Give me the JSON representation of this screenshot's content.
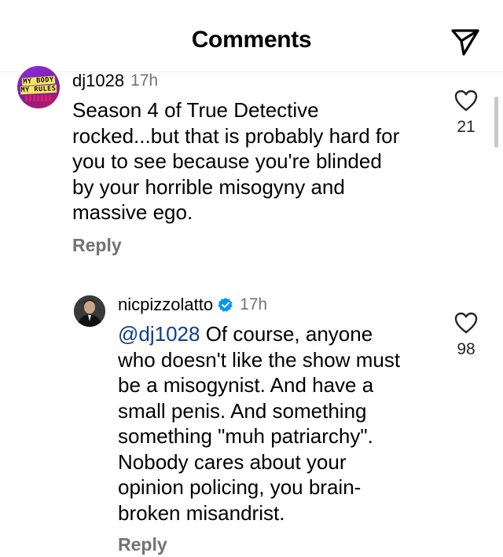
{
  "header": {
    "title": "Comments",
    "share_icon": "paper-plane-icon"
  },
  "comments": [
    {
      "avatar_text_line1": "MY BODY",
      "avatar_text_line2": "MY RULES",
      "username": "dj1028",
      "time": "17h",
      "text_lines": [
        "Season 4 of True Detective",
        "rocked...but that is probably hard for",
        "you to see because you're blinded",
        "by your horrible misogyny and",
        "massive ego."
      ],
      "reply_label": "Reply",
      "like_count": "21"
    },
    {
      "username": "nicpizzolatto",
      "verified": true,
      "time": "17h",
      "mention": "@dj1028",
      "text_first_line_rest": " Of course, anyone",
      "text_lines": [
        "who doesn't like the show must",
        "be a misogynist. And have a",
        "small penis. And something",
        "something \"muh patriarchy\".",
        "Nobody cares about your",
        "opinion policing, you brain-",
        "broken misandrist."
      ],
      "reply_label": "Reply",
      "like_count": "98"
    }
  ],
  "colors": {
    "text": "#000000",
    "secondary": "#737373",
    "mention": "#0f3d8c",
    "verified": "#0095f6"
  }
}
